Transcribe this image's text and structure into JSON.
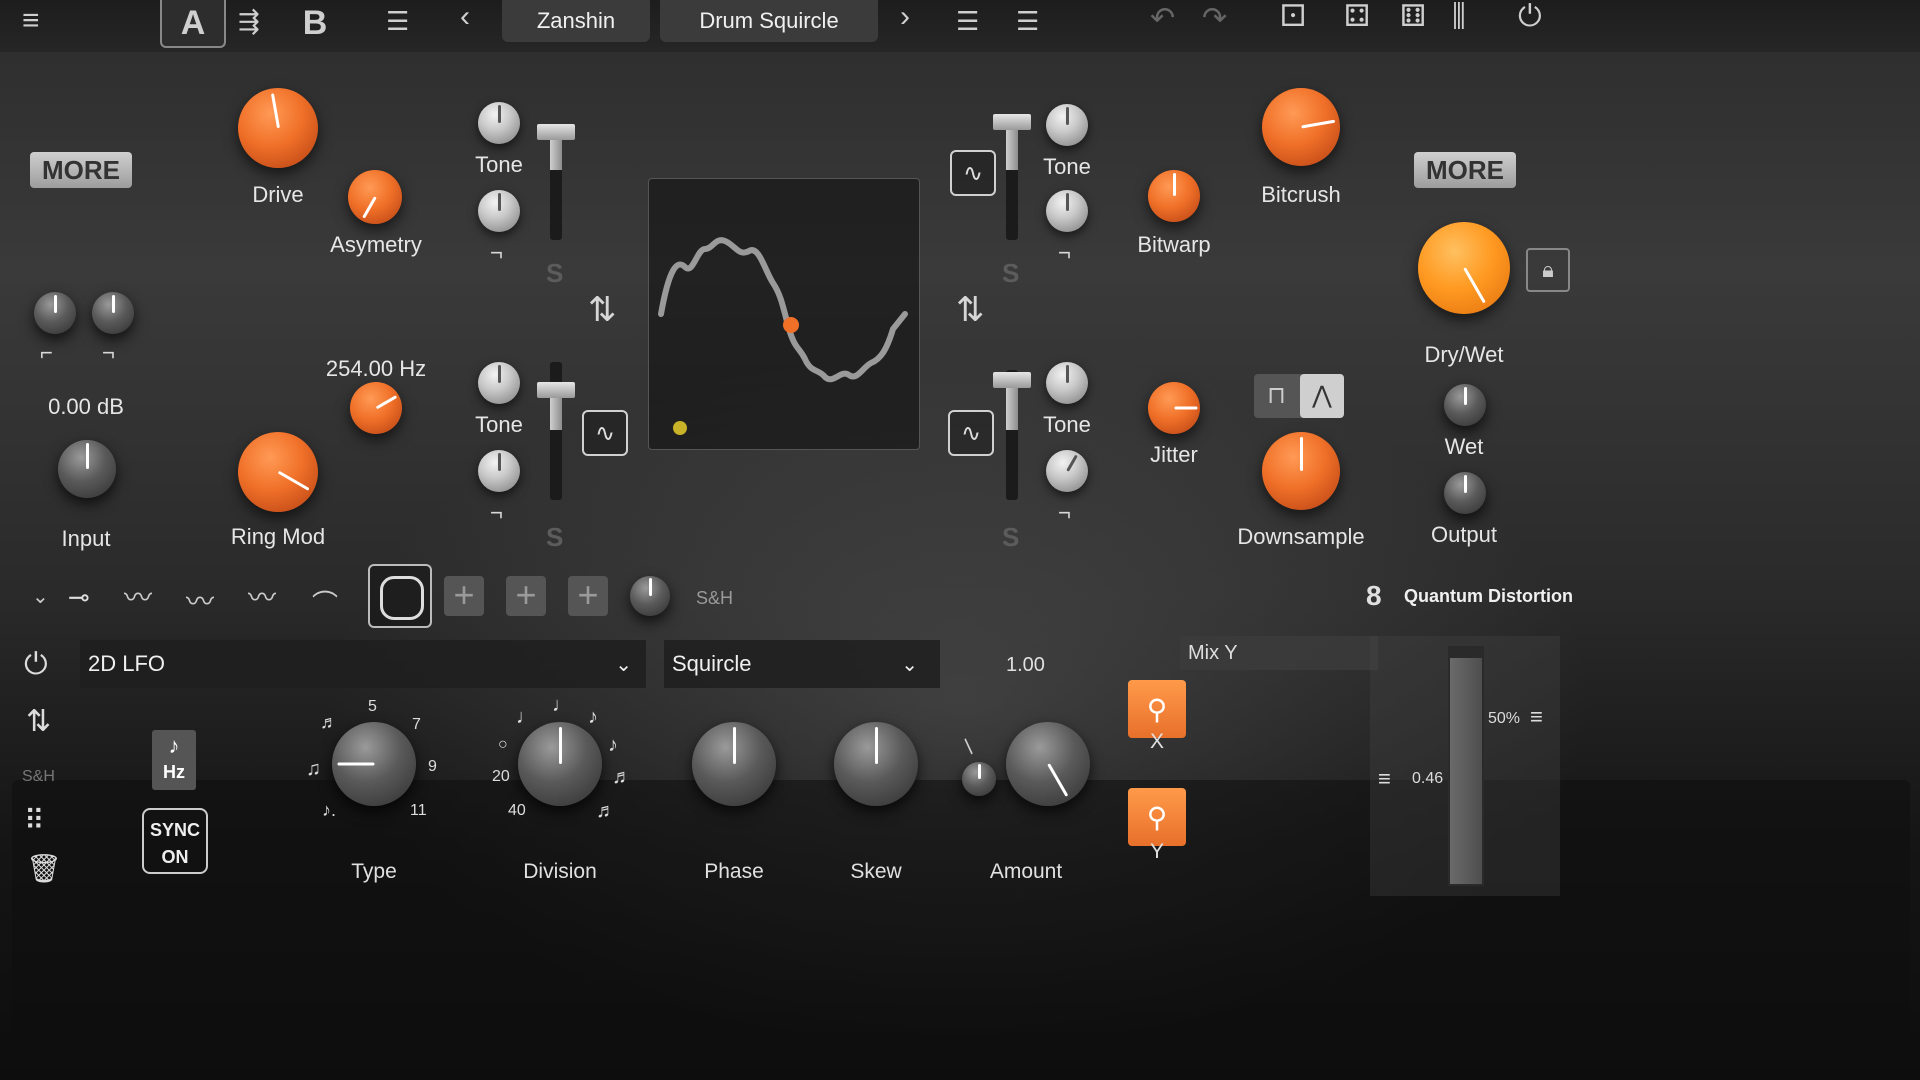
{
  "topbar": {
    "preset_a": "A",
    "preset_b": "B",
    "bank_name": "Zanshin",
    "preset_name": "Drum Squircle",
    "prev": "‹",
    "next": "›"
  },
  "left": {
    "more_label": "MORE",
    "gain_value": "0.00 dB",
    "input_label": "Input"
  },
  "drive_section": {
    "drive_label": "Drive",
    "asymetry_label": "Asymetry",
    "frequency_value": "254.00 Hz",
    "ringmod_label": "Ring Mod"
  },
  "filters": {
    "tone_label": "Tone",
    "s_label": "S"
  },
  "right": {
    "more_label": "MORE",
    "bitcrush_label": "Bitcrush",
    "bitwarp_label": "Bitwarp",
    "jitter_label": "Jitter",
    "downsample_label": "Downsample",
    "drywet_label": "Dry/Wet",
    "wet_label": "Wet",
    "output_label": "Output"
  },
  "lfo_row": {
    "sh_label": "S&H",
    "brand": "Quantum Distortion"
  },
  "bottom": {
    "mod_type": "2D LFO",
    "shape": "Squircle",
    "amount_value": "1.00",
    "mix_label": "Mix Y",
    "hz_label": "Hz",
    "sync_label_1": "SYNC",
    "sync_label_2": "ON",
    "sh_side": "S&H",
    "type_label": "Type",
    "division_label": "Division",
    "phase_label": "Phase",
    "skew_label": "Skew",
    "amount_label": "Amount",
    "x_label": "X",
    "y_label": "Y",
    "pct_value": "50%",
    "mix_value": "0.46",
    "type_ticks": [
      "5",
      "7",
      "9",
      "11"
    ],
    "division_ticks": [
      "20",
      "40"
    ]
  },
  "colors": {
    "accent_orange": "#f07028",
    "lfo_dot_yellow": "#c9b228"
  }
}
